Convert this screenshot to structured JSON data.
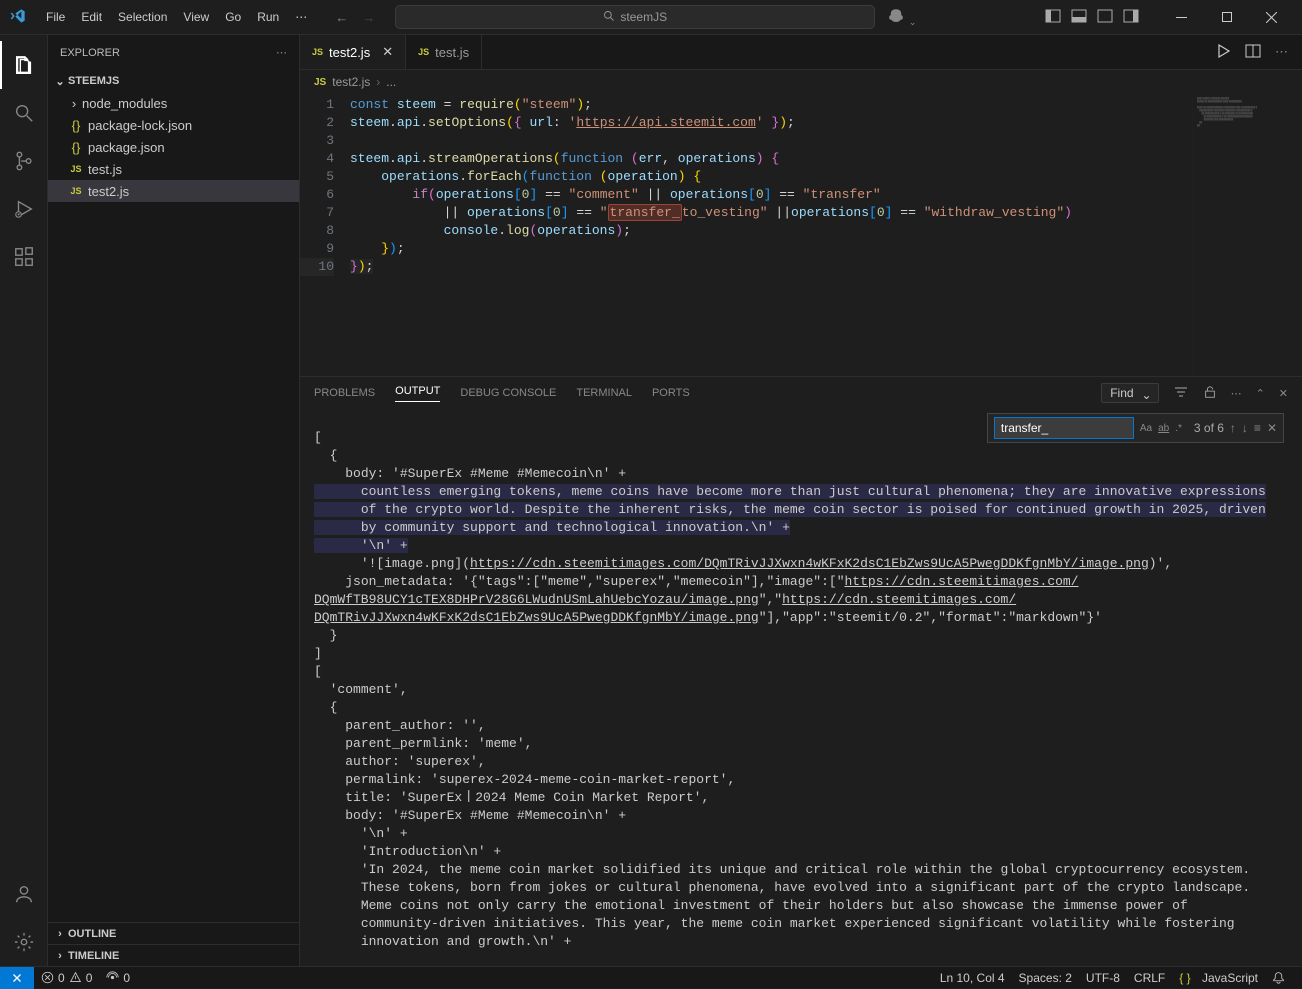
{
  "menubar": {
    "file": "File",
    "edit": "Edit",
    "selection": "Selection",
    "view": "View",
    "go": "Go",
    "run": "Run"
  },
  "search_placeholder": "steemJS",
  "activity": {
    "explorer": "Explorer",
    "search": "Search",
    "scm": "Source Control",
    "run": "Run and Debug",
    "ext": "Extensions",
    "account": "Accounts",
    "settings": "Manage"
  },
  "sidebar": {
    "title": "EXPLORER",
    "root": "STEEMJS",
    "items": [
      {
        "label": "node_modules",
        "icon": "folder",
        "kind": "folder"
      },
      {
        "label": "package-lock.json",
        "icon": "json",
        "kind": "file"
      },
      {
        "label": "package.json",
        "icon": "json",
        "kind": "file"
      },
      {
        "label": "test.js",
        "icon": "js",
        "kind": "file"
      },
      {
        "label": "test2.js",
        "icon": "js",
        "kind": "file",
        "selected": true
      }
    ],
    "outline": "OUTLINE",
    "timeline": "TIMELINE"
  },
  "tabs": [
    {
      "label": "test2.js",
      "active": true
    },
    {
      "label": "test.js",
      "active": false
    }
  ],
  "breadcrumb": {
    "file": "test2.js",
    "more": "..."
  },
  "code": {
    "lines": [
      1,
      2,
      3,
      4,
      5,
      6,
      7,
      8,
      9,
      10
    ]
  },
  "panel": {
    "tabs": {
      "problems": "PROBLEMS",
      "output": "OUTPUT",
      "debug": "DEBUG CONSOLE",
      "terminal": "TERMINAL",
      "ports": "PORTS"
    },
    "find_dropdown": "Find",
    "find": {
      "value": "transfer_",
      "count": "3 of 6"
    }
  },
  "output": {
    "o1": "[",
    "o2": "  {",
    "o3": "    body: '#SuperEx #Meme #Memecoin\\n' +",
    "sel1": "      countless emerging tokens, meme coins have become more than just cultural phenomena; they are innovative expressions",
    "sel2": "      of the crypto world. Despite the inherent risks, the meme coin sector is poised for continued growth in 2025, driven",
    "sel3": "      by community support and technological innovation.\\n' +",
    "o4": "      '\\n' +",
    "o5a": "      '![image.png](",
    "o5link": "https://cdn.steemitimages.com/DQmTRivJJXwxn4wKFxK2dsC1EbZws9UcA5PwegDDKfgnMbY/image.png",
    "o5b": ")',",
    "o6a": "    json_metadata: '{\"tags\":[\"meme\",\"superex\",\"memecoin\"],\"image\":[\"",
    "o6link": "https://cdn.steemitimages.com/",
    "o7link": "DQmWfTB98UCY1cTEX8DHPrV28G6LWudnUSmLahUebcYozau/image.png",
    "o7m": "\",\"",
    "o7link2": "https://cdn.steemitimages.com/",
    "o8link": "DQmTRivJJXwxn4wKFxK2dsC1EbZws9UcA5PwegDDKfgnMbY/image.png",
    "o8b": "\"],\"app\":\"steemit/0.2\",\"format\":\"markdown\"}'",
    "o9": "  }",
    "o10": "]",
    "o11": "[",
    "o12": "  'comment',",
    "o13": "  {",
    "o14": "    parent_author: '',",
    "o15": "    parent_permlink: 'meme',",
    "o16": "    author: 'superex',",
    "o17": "    permalink: 'superex-2024-meme-coin-market-report',",
    "o18": "    title: 'SuperEx丨2024 Meme Coin Market Report',",
    "o19": "    body: '#SuperEx #Meme #Memecoin\\n' +",
    "o20": "      '\\n' +",
    "o21": "      'Introduction\\n' +",
    "o22": "      'In 2024, the meme coin market solidified its unique and critical role within the global cryptocurrency ecosystem.",
    "o23": "      These tokens, born from jokes or cultural phenomena, have evolved into a significant part of the crypto landscape.",
    "o24": "      Meme coins not only carry the emotional investment of their holders but also showcase the immense power of",
    "o25": "      community-driven initiatives. This year, the meme coin market experienced significant volatility while fostering",
    "o26": "      innovation and growth.\\n' +"
  },
  "status": {
    "errors": "0",
    "warnings": "0",
    "ports": "0",
    "cursor": "Ln 10, Col 4",
    "spaces": "Spaces: 2",
    "encoding": "UTF-8",
    "eol": "CRLF",
    "lang": "JavaScript"
  }
}
